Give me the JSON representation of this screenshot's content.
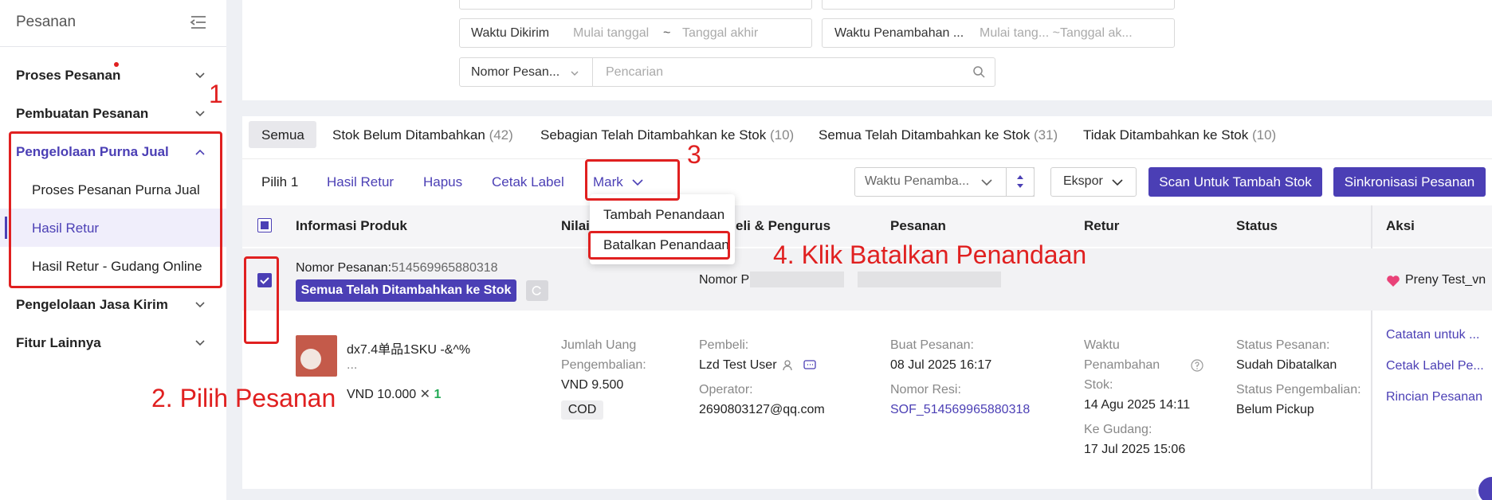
{
  "sidebar": {
    "title": "Pesanan",
    "items": [
      {
        "label": "Proses Pesanan"
      },
      {
        "label": "Pembuatan Pesanan"
      },
      {
        "label": "Pengelolaan Purna Jual"
      },
      {
        "label": "Pengelolaan Jasa Kirim"
      },
      {
        "label": "Fitur Lainnya"
      }
    ],
    "subitems": [
      {
        "label": "Proses Pesanan Purna Jual"
      },
      {
        "label": "Hasil Retur"
      },
      {
        "label": "Hasil Retur - Gudang Online"
      }
    ]
  },
  "filters": {
    "sent_label": "Waktu Dikirim",
    "sent_start": "Mulai tanggal",
    "sent_sep": "~",
    "sent_end": "Tanggal akhir",
    "added_label": "Waktu Penambahan ...",
    "added_range": "Mulai tang... ~Tanggal ak...",
    "order_select": "Nomor Pesan...",
    "search_placeholder": "Pencarian"
  },
  "tabs": [
    {
      "label": "Semua",
      "count": ""
    },
    {
      "label": "Stok Belum Ditambahkan",
      "count": "(42)"
    },
    {
      "label": "Sebagian Telah Ditambahkan ke Stok",
      "count": "(10)"
    },
    {
      "label": "Semua Telah Ditambahkan ke Stok",
      "count": "(31)"
    },
    {
      "label": "Tidak Ditambahkan ke Stok",
      "count": "(10)"
    }
  ],
  "toolbar": {
    "selected": "Pilih 1",
    "hasil_retur": "Hasil Retur",
    "hapus": "Hapus",
    "cetak_label": "Cetak Label",
    "mark": "Mark",
    "sort_select": "Waktu Penamba...",
    "ekspor": "Ekspor",
    "scan": "Scan Untuk Tambah Stok",
    "sync": "Sinkronisasi Pesanan"
  },
  "dropdown": {
    "items": [
      "Tambah Penandaan",
      "Batalkan Penandaan"
    ]
  },
  "table": {
    "headers": [
      "Informasi Produk",
      "Nilai",
      "eli & Pengurus",
      "Pesanan",
      "Retur",
      "Status",
      "Aksi"
    ]
  },
  "order": {
    "number_label": "Nomor Pesanan:",
    "number": "514569965880318",
    "badge": "Semua Telah Ditambahkan ke Stok",
    "nomor_prefix": "Nomor P",
    "shop": "Preny Test_vn"
  },
  "product": {
    "name": "dx7.4单品1SKU -&^%",
    "name2": "...",
    "price": "VND 10.000",
    "times": "✕",
    "qty": "1",
    "refund_label1": "Jumlah Uang",
    "refund_label2": "Pengembalian:",
    "refund_value": "VND 9.500",
    "payment": "COD",
    "buyer_label": "Pembeli:",
    "buyer": "Lzd Test User",
    "operator_label": "Operator:",
    "operator": "2690803127@qq.com",
    "created_label": "Buat Pesanan:",
    "created": "08 Jul 2025 16:17",
    "resi_label": "Nomor Resi:",
    "resi": "SOF_514569965880318",
    "stock_label1": "Waktu",
    "stock_label2": "Penambahan",
    "stock_label3": "Stok:",
    "stock_time": "14 Agu 2025 14:11",
    "warehouse_label": "Ke Gudang:",
    "warehouse_time": "17 Jul 2025 15:06",
    "order_status_label": "Status Pesanan:",
    "order_status": "Sudah Dibatalkan",
    "return_status_label": "Status Pengembalian:",
    "return_status": "Belum Pickup",
    "actions": [
      "Catatan untuk ...",
      "Cetak Label Pe...",
      "Rincian Pesanan"
    ]
  },
  "annotations": {
    "step1": "1",
    "step2": "2. Pilih Pesanan",
    "step3": "3",
    "step4": "4. Klik Batalkan Penandaan",
    "color": "#e02020"
  },
  "colors": {
    "accent": "#4b3fb5",
    "notification_dot": "#e02020"
  }
}
